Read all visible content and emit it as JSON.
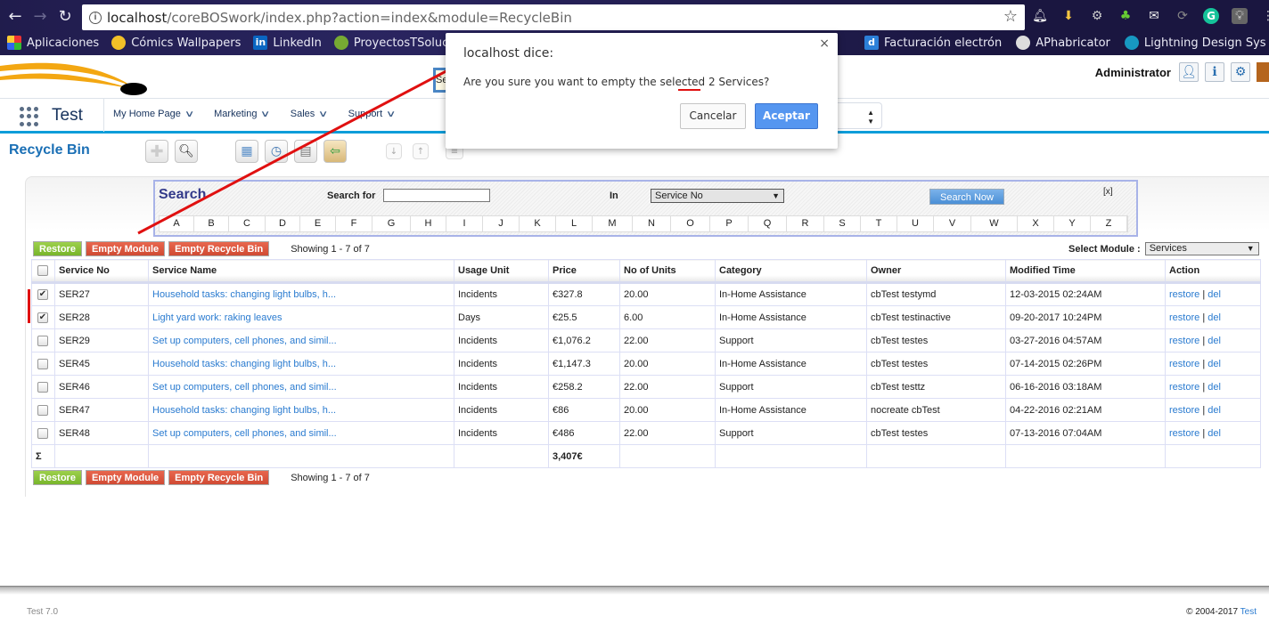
{
  "browser": {
    "url_host": "localhost",
    "url_path": "/coreBOSwork/index.php?action=index&module=RecycleBin",
    "bookmarks_left": [
      "Aplicaciones",
      "Cómics Wallpapers",
      "LinkedIn",
      "ProyectosTSolucio"
    ],
    "bookmarks_right": [
      "Facturación electrón",
      "APhabricator",
      "Lightning Design Sys"
    ]
  },
  "header": {
    "user_name": "Administrator",
    "global_search_placeholder": "Se"
  },
  "navbar": {
    "app_name": "Test",
    "menu": [
      "My Home Page",
      "Marketing",
      "Sales",
      "Support"
    ]
  },
  "page": {
    "title": "Recycle Bin"
  },
  "search": {
    "title": "Search",
    "search_for_label": "Search for",
    "search_for_value": "",
    "in_label": "In",
    "in_selected": "Service No",
    "search_now_label": "Search Now",
    "close_label": "[x]",
    "alphabet": [
      "A",
      "B",
      "C",
      "D",
      "E",
      "F",
      "G",
      "H",
      "I",
      "J",
      "K",
      "L",
      "M",
      "N",
      "O",
      "P",
      "Q",
      "R",
      "S",
      "T",
      "U",
      "V",
      "W",
      "X",
      "Y",
      "Z"
    ]
  },
  "actions": {
    "restore_label": "Restore",
    "empty_module_label": "Empty Module",
    "empty_recycle_bin_label": "Empty Recycle Bin",
    "showing": "Showing 1 - 7 of 7",
    "select_module_label": "Select Module :",
    "select_module_value": "Services"
  },
  "table": {
    "columns": [
      "Service No",
      "Service Name",
      "Usage Unit",
      "Price",
      "No of Units",
      "Category",
      "Owner",
      "Modified Time",
      "Action"
    ],
    "rows": [
      {
        "checked": true,
        "no": "SER27",
        "name": "Household tasks: changing light bulbs, h...",
        "unit": "Incidents",
        "price": "€327.8",
        "units": "20.00",
        "category": "In-Home Assistance",
        "owner": "cbTest testymd",
        "modified": "12-03-2015 02:24AM"
      },
      {
        "checked": true,
        "no": "SER28",
        "name": "Light yard work: raking leaves",
        "unit": "Days",
        "price": "€25.5",
        "units": "6.00",
        "category": "In-Home Assistance",
        "owner": "cbTest testinactive",
        "modified": "09-20-2017 10:24PM"
      },
      {
        "checked": false,
        "no": "SER29",
        "name": "Set up computers, cell phones, and simil...",
        "unit": "Incidents",
        "price": "€1,076.2",
        "units": "22.00",
        "category": "Support",
        "owner": "cbTest testes",
        "modified": "03-27-2016 04:57AM"
      },
      {
        "checked": false,
        "no": "SER45",
        "name": "Household tasks: changing light bulbs, h...",
        "unit": "Incidents",
        "price": "€1,147.3",
        "units": "20.00",
        "category": "In-Home Assistance",
        "owner": "cbTest testes",
        "modified": "07-14-2015 02:26PM"
      },
      {
        "checked": false,
        "no": "SER46",
        "name": "Set up computers, cell phones, and simil...",
        "unit": "Incidents",
        "price": "€258.2",
        "units": "22.00",
        "category": "Support",
        "owner": "cbTest testtz",
        "modified": "06-16-2016 03:18AM"
      },
      {
        "checked": false,
        "no": "SER47",
        "name": "Household tasks: changing light bulbs, h...",
        "unit": "Incidents",
        "price": "€86",
        "units": "20.00",
        "category": "In-Home Assistance",
        "owner": "nocreate cbTest",
        "modified": "04-22-2016 02:21AM"
      },
      {
        "checked": false,
        "no": "SER48",
        "name": "Set up computers, cell phones, and simil...",
        "unit": "Incidents",
        "price": "€486",
        "units": "22.00",
        "category": "Support",
        "owner": "cbTest testes",
        "modified": "07-13-2016 07:04AM"
      }
    ],
    "restore_link": "restore",
    "del_link": "del",
    "separator": "|",
    "sum_symbol": "Σ",
    "sum_price": "3,407€"
  },
  "dialog": {
    "title": "localhost dice:",
    "message": "Are you sure you want to empty the selected 2 Services?",
    "cancel_label": "Cancelar",
    "ok_label": "Aceptar",
    "close_glyph": "×"
  },
  "footer": {
    "version": "Test 7.0",
    "copyright": "© 2004-2017",
    "brand_link": "Test"
  },
  "colors": {
    "accent_blue": "#0d9dd9",
    "link_blue": "#2a7bd0",
    "restore_green": "#78b52b",
    "danger_red": "#d04a33",
    "annotation_red": "#e01010"
  }
}
